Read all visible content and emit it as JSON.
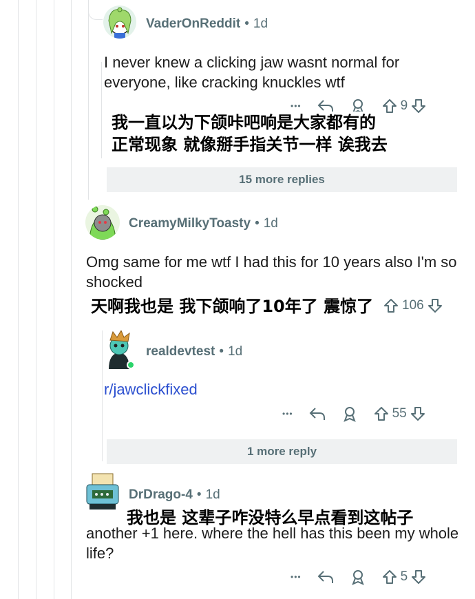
{
  "comments": [
    {
      "username": "VaderOnReddit",
      "age": "1d",
      "body": "I never knew a clicking jaw wasnt normal for everyone, like cracking knuckles wtf",
      "votes": "9",
      "translation": [
        "我一直以为下颌咔吧响是大家都有的",
        "正常现象 就像掰手指关节一样 诶我去"
      ],
      "more_replies": "15 more replies"
    },
    {
      "username": "CreamyMilkyToasty",
      "age": "1d",
      "body": "Omg same for me wtf I had this for 10 years also I'm so shocked",
      "votes": "106",
      "translation": "天啊我也是 我下颌响了10年了 震惊了"
    },
    {
      "username": "realdevtest",
      "age": "1d",
      "body": "r/jawclickfixed",
      "votes": "55",
      "more_replies": "1 more reply"
    },
    {
      "username": "DrDrago-4",
      "age": "1d",
      "body": "another +1 here. where the hell has this been my whole life?",
      "votes": "5",
      "translation": "我也是 这辈子咋没特么早点看到这帖子"
    }
  ],
  "ui": {
    "dot_sep": "•",
    "more_dots": "•••"
  },
  "colors": {
    "meta": "#576f76",
    "link": "#2a4ecf",
    "button_bg": "#eff1f2"
  }
}
